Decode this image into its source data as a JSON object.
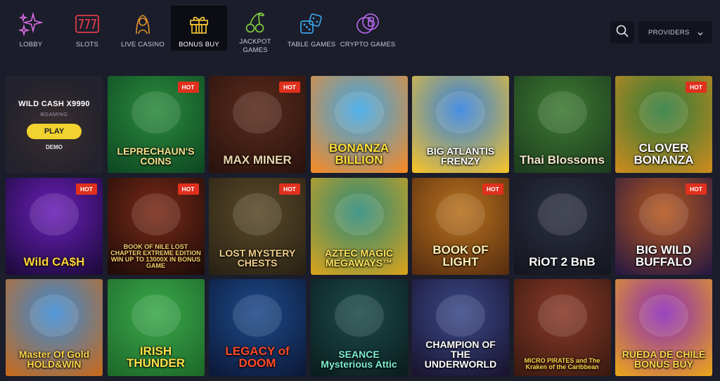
{
  "nav": {
    "items": [
      {
        "label": "LOBBY",
        "icon": "sparkles-icon",
        "color": "#d86be0"
      },
      {
        "label": "SLOTS",
        "icon": "slot-777-icon",
        "color": "#e23b4a"
      },
      {
        "label": "LIVE CASINO",
        "icon": "dealer-icon",
        "color": "#e0922b"
      },
      {
        "label": "BONUS BUY",
        "icon": "gift-icon",
        "color": "#f1c232"
      },
      {
        "label": "JACKPOT GAMES",
        "icon": "cherries-icon",
        "color": "#7fcc3d"
      },
      {
        "label": "TABLE GAMES",
        "icon": "dice-icon",
        "color": "#3aa3e6"
      },
      {
        "label": "CRYPTO GAMES",
        "icon": "crypto-coin-icon",
        "color": "#b065e6"
      }
    ],
    "active_index": 3
  },
  "search": {
    "icon": "search-icon"
  },
  "providers": {
    "label": "PROVIDERS",
    "icon": "chevron-down-icon"
  },
  "featured": {
    "title": "WILD CASH X9990",
    "provider": "BGAMING",
    "play_label": "PLAY",
    "demo_label": "DEMO"
  },
  "hot_label": "HOT",
  "games": [
    {
      "title": "LEPRECHAUN'S COINS",
      "hot": true,
      "bg": "#2b8a3e",
      "bg2": "#0f4a22",
      "text_color": "#f6e28a"
    },
    {
      "title": "MAX MINER",
      "hot": true,
      "bg": "#5a2b1c",
      "bg2": "#2a130d",
      "text_color": "#e8d7b0"
    },
    {
      "title": "BONANZA BILLION",
      "hot": false,
      "bg": "#39a6e8",
      "bg2": "#f28b2a",
      "text_color": "#ffde3b"
    },
    {
      "title": "BIG ATLANTIS FRENZY",
      "hot": false,
      "bg": "#2f7fe0",
      "bg2": "#f2c12e",
      "text_color": "#ffffff"
    },
    {
      "title": "Thai Blossoms",
      "hot": false,
      "bg": "#3f7a33",
      "bg2": "#1d3d1e",
      "text_color": "#f4e6c9"
    },
    {
      "title": "CLOVER BONANZA",
      "hot": true,
      "bg": "#2a7a3a",
      "bg2": "#c98a1e",
      "text_color": "#ffffff"
    },
    {
      "title": "Wild CA$H",
      "hot": true,
      "bg": "#6a1fb8",
      "bg2": "#1d0a3d",
      "text_color": "#ffd33a"
    },
    {
      "title": "BOOK OF NILE LOST CHAPTER EXTREME EDITION WIN UP TO 13000X IN BONUS GAME",
      "hot": true,
      "bg": "#7a2a18",
      "bg2": "#1f0c08",
      "text_color": "#f6d06a"
    },
    {
      "title": "LOST MYSTERY CHESTS",
      "hot": true,
      "bg": "#5a4a2a",
      "bg2": "#2a2214",
      "text_color": "#f1d08a"
    },
    {
      "title": "AZTEC MAGIC MEGAWAYS™",
      "hot": false,
      "bg": "#2a8a7a",
      "bg2": "#d4a21e",
      "text_color": "#ffe35a"
    },
    {
      "title": "BOOK OF LIGHT",
      "hot": true,
      "bg": "#b8721e",
      "bg2": "#5a2f10",
      "text_color": "#fff0b3"
    },
    {
      "title": "RiOT 2 BnB",
      "hot": false,
      "bg": "#2c3040",
      "bg2": "#14161f",
      "text_color": "#ffffff"
    },
    {
      "title": "BIG WILD BUFFALO",
      "hot": true,
      "bg": "#b8581e",
      "bg2": "#2a1a40",
      "text_color": "#ffffff"
    },
    {
      "title": "Master Of Gold HOLD&WIN",
      "hot": false,
      "bg": "#3a8ad6",
      "bg2": "#c46a1e",
      "text_color": "#ffd84a"
    },
    {
      "title": "IRISH THUNDER",
      "hot": false,
      "bg": "#3aa84a",
      "bg2": "#1e6a2a",
      "text_color": "#ffe04a"
    },
    {
      "title": "LEGACY of DOOM",
      "hot": false,
      "bg": "#1e4a8a",
      "bg2": "#0c1a3a",
      "text_color": "#ff4a2a"
    },
    {
      "title": "SEANCE Mysterious Attic",
      "hot": false,
      "bg": "#1e4a4a",
      "bg2": "#0a1e1e",
      "text_color": "#7ef0d0"
    },
    {
      "title": "CHAMPION OF THE UNDERWORLD",
      "hot": false,
      "bg": "#3a4a8a",
      "bg2": "#1a1430",
      "text_color": "#ffffff"
    },
    {
      "title": "MICRO PIRATES and The Kraken of the Caribbean",
      "hot": false,
      "bg": "#8a3a2a",
      "bg2": "#3a1a10",
      "text_color": "#ffd84a"
    },
    {
      "title": "RUEDA DE CHILE BONUS BUY",
      "hot": false,
      "bg": "#8a2ab8",
      "bg2": "#e8a21e",
      "text_color": "#ffd84a"
    }
  ]
}
